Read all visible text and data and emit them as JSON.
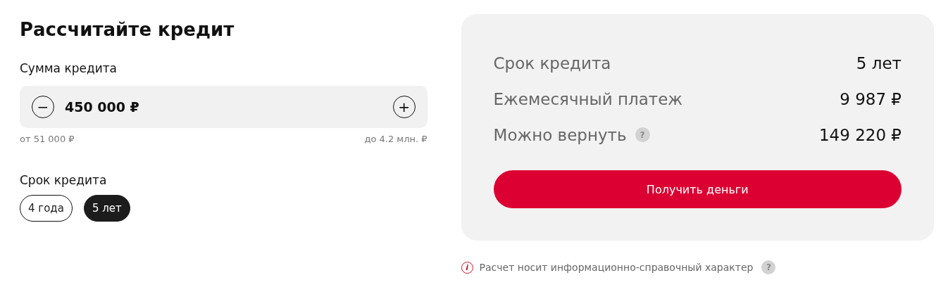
{
  "title": "Рассчитайте кредит",
  "amount": {
    "label": "Сумма кредита",
    "value": "450 000 ₽",
    "decrease": "−",
    "increase": "+",
    "min": "от 51 000 ₽",
    "max": "до 4.2 млн. ₽"
  },
  "term": {
    "label": "Срок кредита",
    "options": [
      {
        "label": "4 года",
        "selected": false
      },
      {
        "label": "5 лет",
        "selected": true
      }
    ]
  },
  "summary": {
    "rows": [
      {
        "label": "Срок кредита",
        "value": "5 лет"
      },
      {
        "label": "Ежемесячный платеж",
        "value": "9 987 ₽"
      },
      {
        "label": "Можно вернуть",
        "help": "?",
        "value": "149 220 ₽"
      }
    ],
    "button": "Получить деньги"
  },
  "note": {
    "icon": "i",
    "text": "Расчет носит информационно-справочный характер",
    "help": "?"
  }
}
